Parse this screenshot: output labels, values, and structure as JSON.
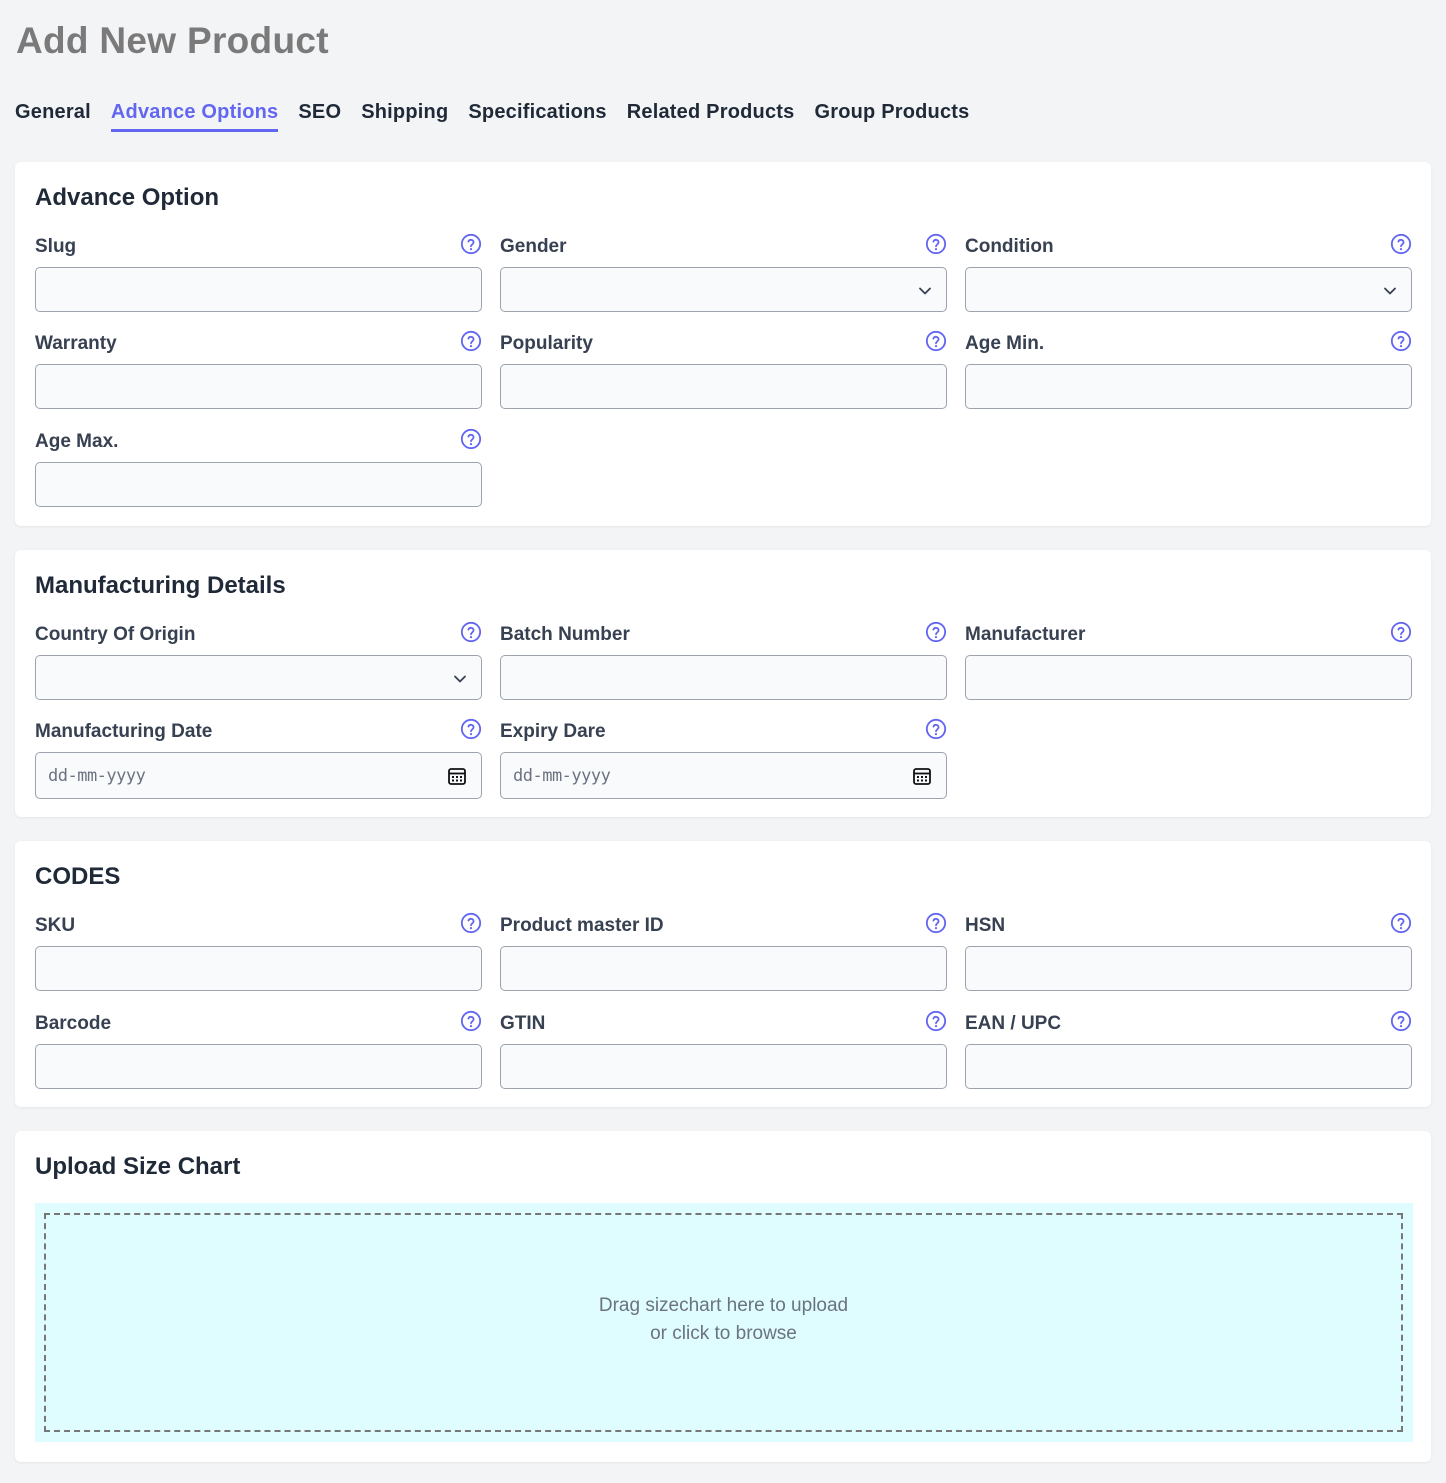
{
  "page": {
    "title": "Add New Product"
  },
  "tabs": [
    {
      "label": "General",
      "active": false
    },
    {
      "label": "Advance Options",
      "active": true
    },
    {
      "label": "SEO",
      "active": false
    },
    {
      "label": "Shipping",
      "active": false
    },
    {
      "label": "Specifications",
      "active": false
    },
    {
      "label": "Related Products",
      "active": false
    },
    {
      "label": "Group Products",
      "active": false
    }
  ],
  "colors": {
    "accent": "#6366f1",
    "dropzone_bg": "#dffdfe",
    "page_bg": "#f3f4f6"
  },
  "advance_option": {
    "title": "Advance Option",
    "slug": {
      "label": "Slug",
      "value": ""
    },
    "gender": {
      "label": "Gender",
      "value": ""
    },
    "condition": {
      "label": "Condition",
      "value": ""
    },
    "warranty": {
      "label": "Warranty",
      "value": ""
    },
    "popularity": {
      "label": "Popularity",
      "value": ""
    },
    "age_min": {
      "label": "Age Min.",
      "value": ""
    },
    "age_max": {
      "label": "Age Max.",
      "value": ""
    }
  },
  "manufacturing": {
    "title": "Manufacturing Details",
    "country": {
      "label": "Country Of Origin",
      "value": ""
    },
    "batch": {
      "label": "Batch Number",
      "value": ""
    },
    "manufacturer": {
      "label": "Manufacturer",
      "value": ""
    },
    "mfg_date": {
      "label": "Manufacturing Date",
      "placeholder": "dd-mm-yyyy"
    },
    "expiry_date": {
      "label": "Expiry Dare",
      "placeholder": "dd-mm-yyyy"
    }
  },
  "codes": {
    "title": "CODES",
    "sku": {
      "label": "SKU",
      "value": ""
    },
    "master_id": {
      "label": "Product master ID",
      "value": ""
    },
    "hsn": {
      "label": "HSN",
      "value": ""
    },
    "barcode": {
      "label": "Barcode",
      "value": ""
    },
    "gtin": {
      "label": "GTIN",
      "value": ""
    },
    "ean": {
      "label": "EAN / UPC",
      "value": ""
    }
  },
  "size_chart": {
    "title": "Upload Size Chart",
    "line1": "Drag sizechart here to upload",
    "line2": "or click to browse"
  },
  "icons": {
    "help": "help-circle-icon",
    "select": "chevron-down-icon",
    "date": "calendar-icon"
  }
}
